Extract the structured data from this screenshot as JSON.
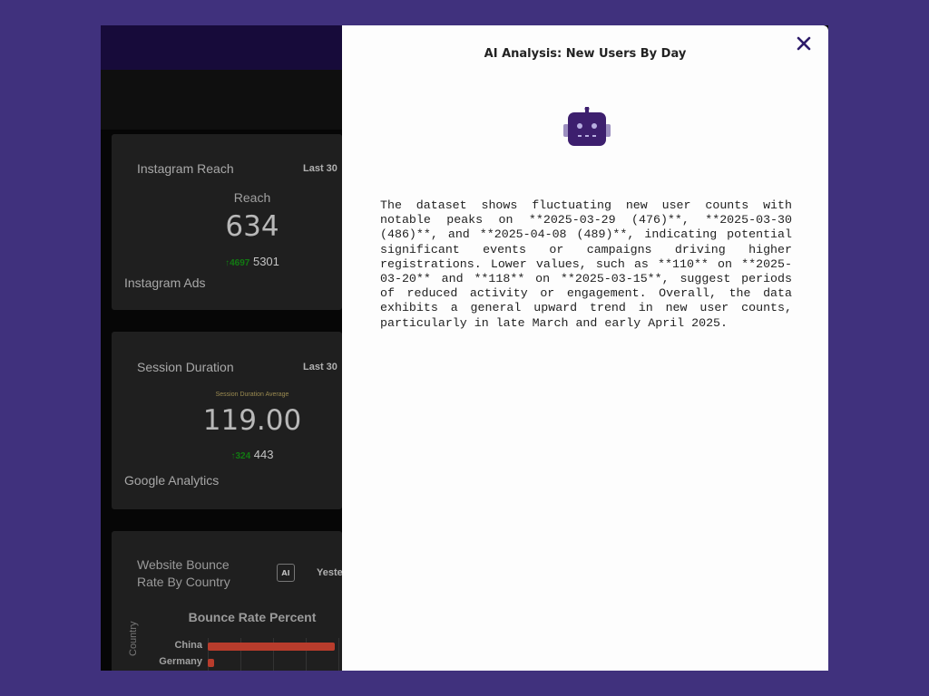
{
  "dashboard": {
    "cards": [
      {
        "title": "Instagram Reach",
        "period": "Last 30",
        "caption": "Reach",
        "value": "634",
        "delta": "4697",
        "delta_ref": "5301",
        "source": "Instagram Ads"
      },
      {
        "title": "Session Duration",
        "period": "Last 30",
        "caption": "Session Duration Average",
        "value": "119.00",
        "delta": "324",
        "delta_ref": "443",
        "source": "Google Analytics"
      }
    ],
    "bounce_card": {
      "title": "Website Bounce Rate By Country",
      "ai_badge": "AI",
      "period": "Yeste",
      "chart_data": {
        "type": "bar",
        "title": "Bounce Rate Percent",
        "ylabel": "Country",
        "categories": [
          "China",
          "Germany"
        ],
        "values": [
          100,
          5
        ]
      }
    }
  },
  "modal": {
    "title": "AI Analysis: New Users By Day",
    "close_icon": "close-icon",
    "robot_icon": "robot-icon",
    "analysis_text": "The dataset shows fluctuating new user counts with notable peaks on **2025-03-29 (476)**, **2025-03-30 (486)**, and **2025-04-08 (489)**, indicating potential significant events or campaigns driving higher registrations. Lower values, such as **110** on **2025-03-20** and **118** on **2025-03-15**, suggest periods of reduced activity or engagement. Overall, the data exhibits a general upward trend in new user counts, particularly in late March and early April 2025."
  },
  "colors": {
    "page_background": "#40317d",
    "robot": "#3d1f6e",
    "close": "#2d1b69",
    "bar": "#b83c2c",
    "delta_up": "#127a12"
  }
}
